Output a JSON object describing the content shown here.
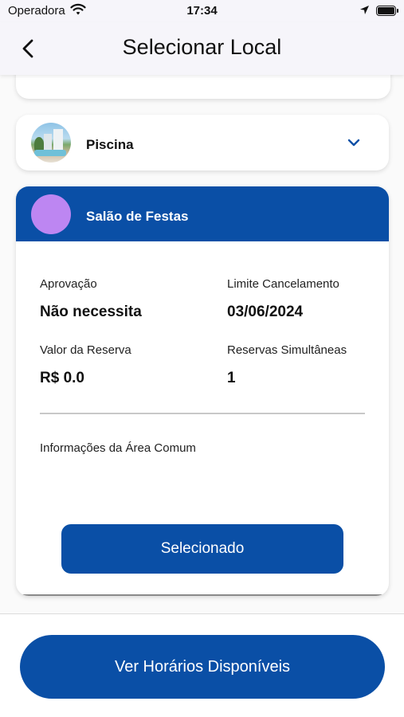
{
  "status_bar": {
    "carrier": "Operadora",
    "time": "17:34",
    "icons": [
      "wifi-icon",
      "location-arrow-icon",
      "battery-icon"
    ]
  },
  "nav": {
    "title": "Selecionar Local",
    "back_icon": "chevron-left-icon"
  },
  "locations": [
    {
      "name": "Piscina",
      "state": "collapsed",
      "icon": "chevron-down-icon"
    },
    {
      "name": "Salão de Festas",
      "state": "expanded",
      "avatar_color": "#bd86f2",
      "details": {
        "approval_label": "Aprovação",
        "approval_value": "Não necessita",
        "cancel_limit_label": "Limite Cancelamento",
        "cancel_limit_value": "03/06/2024",
        "price_label": "Valor da Reserva",
        "price_value": "R$ 0.0",
        "simultaneous_label": "Reservas Simultâneas",
        "simultaneous_value": "1",
        "info_label": "Informações da Área Comum"
      },
      "select_button": "Selecionado"
    }
  ],
  "primary_button": "Ver Horários Disponíveis",
  "colors": {
    "brand_blue": "#0a4fa6",
    "nav_bg": "#f6f5fa"
  }
}
